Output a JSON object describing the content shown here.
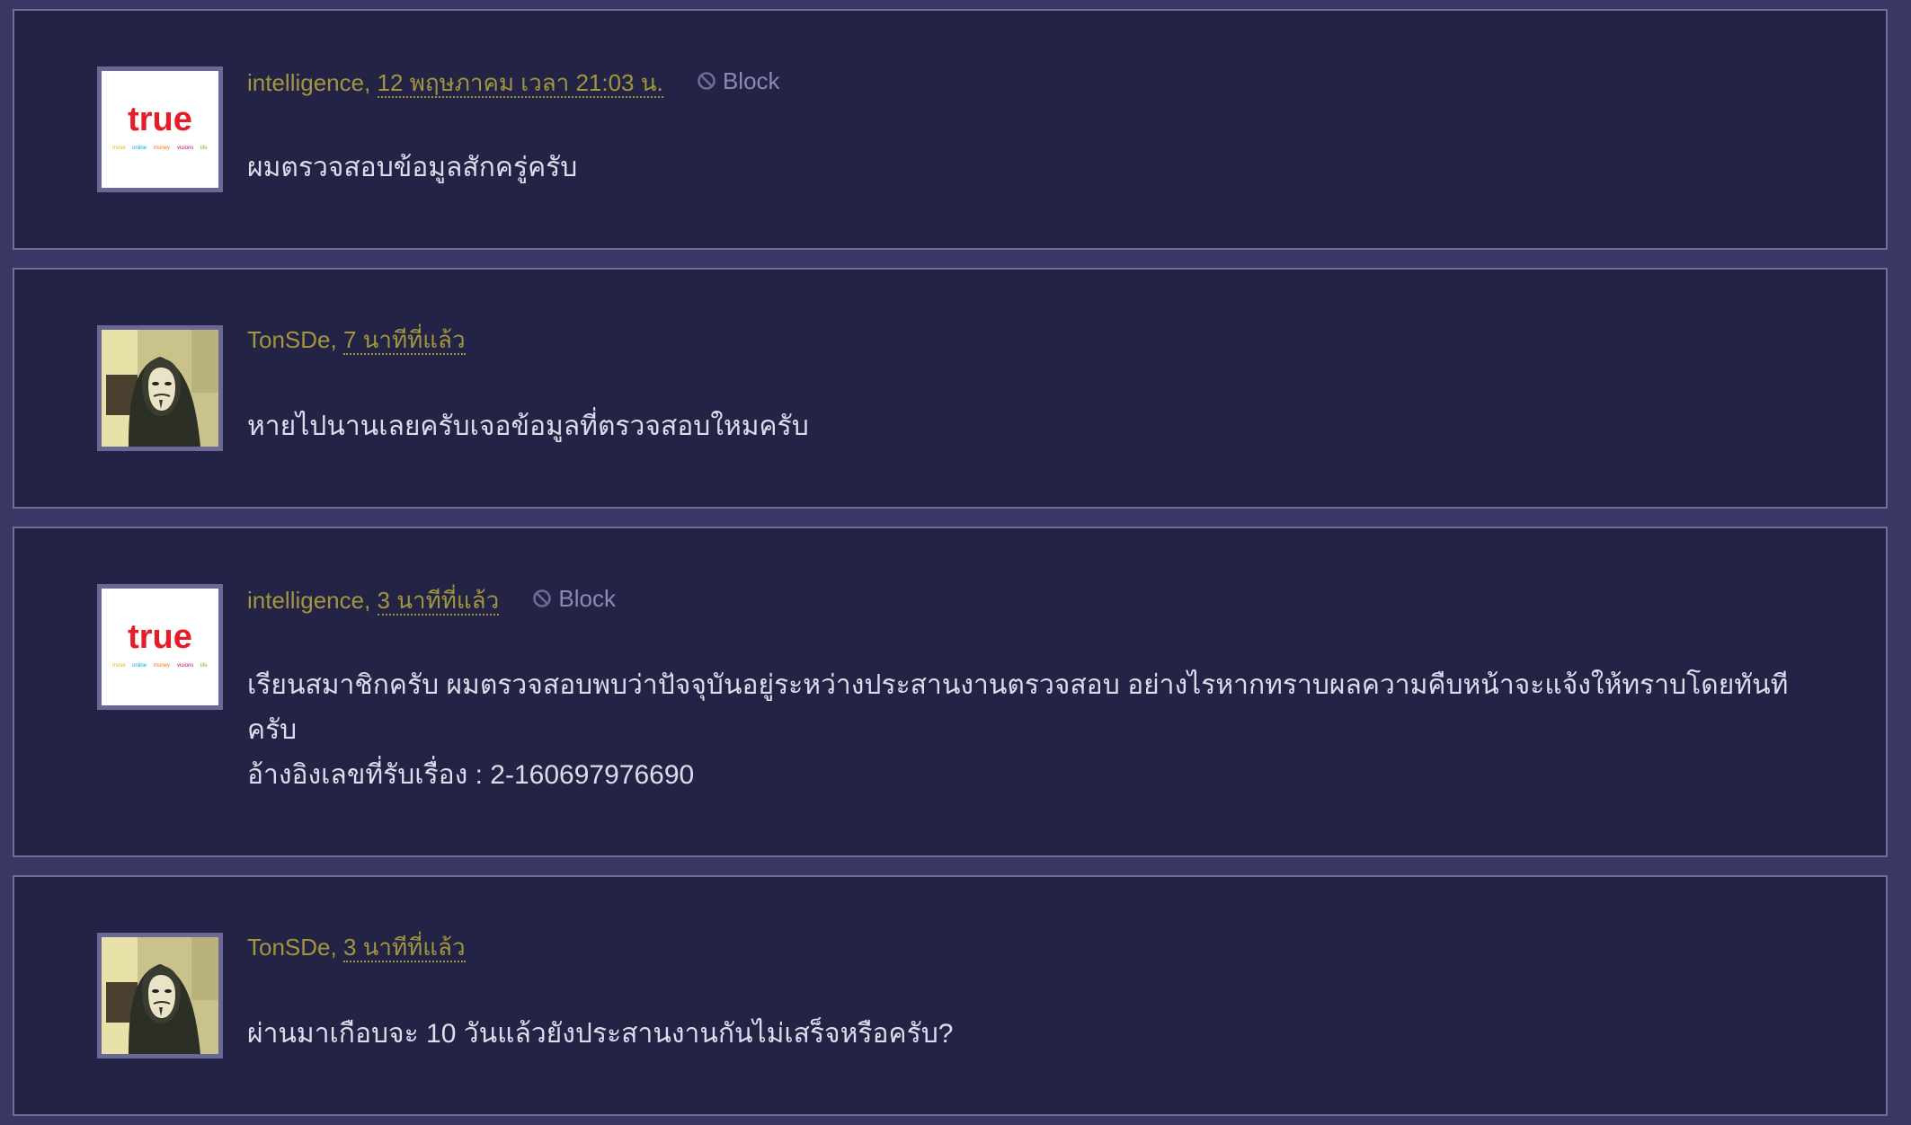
{
  "colors": {
    "page_background": "#3b3764",
    "card_background": "#232445",
    "card_border": "#706c9c",
    "author_color": "#a3943e",
    "block_color": "#8b87b8",
    "text_color": "#dcdcec",
    "true_brand_red": "#e41e26"
  },
  "comments": [
    {
      "author": "intelligence,",
      "time": "12 พฤษภาคม เวลา 21:03 น.",
      "block_label": "Block",
      "avatar_icon": "true-logo",
      "avatar_text": "true",
      "avatar_tagline": [
        "move",
        "online",
        "money",
        "visions",
        "life"
      ],
      "lines": [
        "ผมตรวจสอบข้อมูลสักครู่ครับ"
      ]
    },
    {
      "author": "TonSDe,",
      "time": "7 นาทีที่แล้ว",
      "avatar_icon": "masked-user-photo",
      "lines": [
        "หายไปนานเลยครับเจอข้อมูลที่ตรวจสอบใหมครับ"
      ]
    },
    {
      "author": "intelligence,",
      "time": "3 นาทีที่แล้ว",
      "block_label": "Block",
      "avatar_icon": "true-logo",
      "avatar_text": "true",
      "avatar_tagline": [
        "move",
        "online",
        "money",
        "visions",
        "life"
      ],
      "lines": [
        "เรียนสมาชิกครับ ผมตรวจสอบพบว่าปัจจุบันอยู่ระหว่างประสานงานตรวจสอบ อย่างไรหากทราบผลความคืบหน้าจะแจ้งให้ทราบโดยทันที",
        "ครับ",
        "อ้างอิงเลขที่รับเรื่อง : 2-160697976690"
      ]
    },
    {
      "author": "TonSDe,",
      "time": "3 นาทีที่แล้ว",
      "avatar_icon": "masked-user-photo",
      "lines": [
        "ผ่านมาเกือบจะ 10 วันแล้วยังประสานงานกันไม่เสร็จหรือครับ?"
      ]
    }
  ]
}
